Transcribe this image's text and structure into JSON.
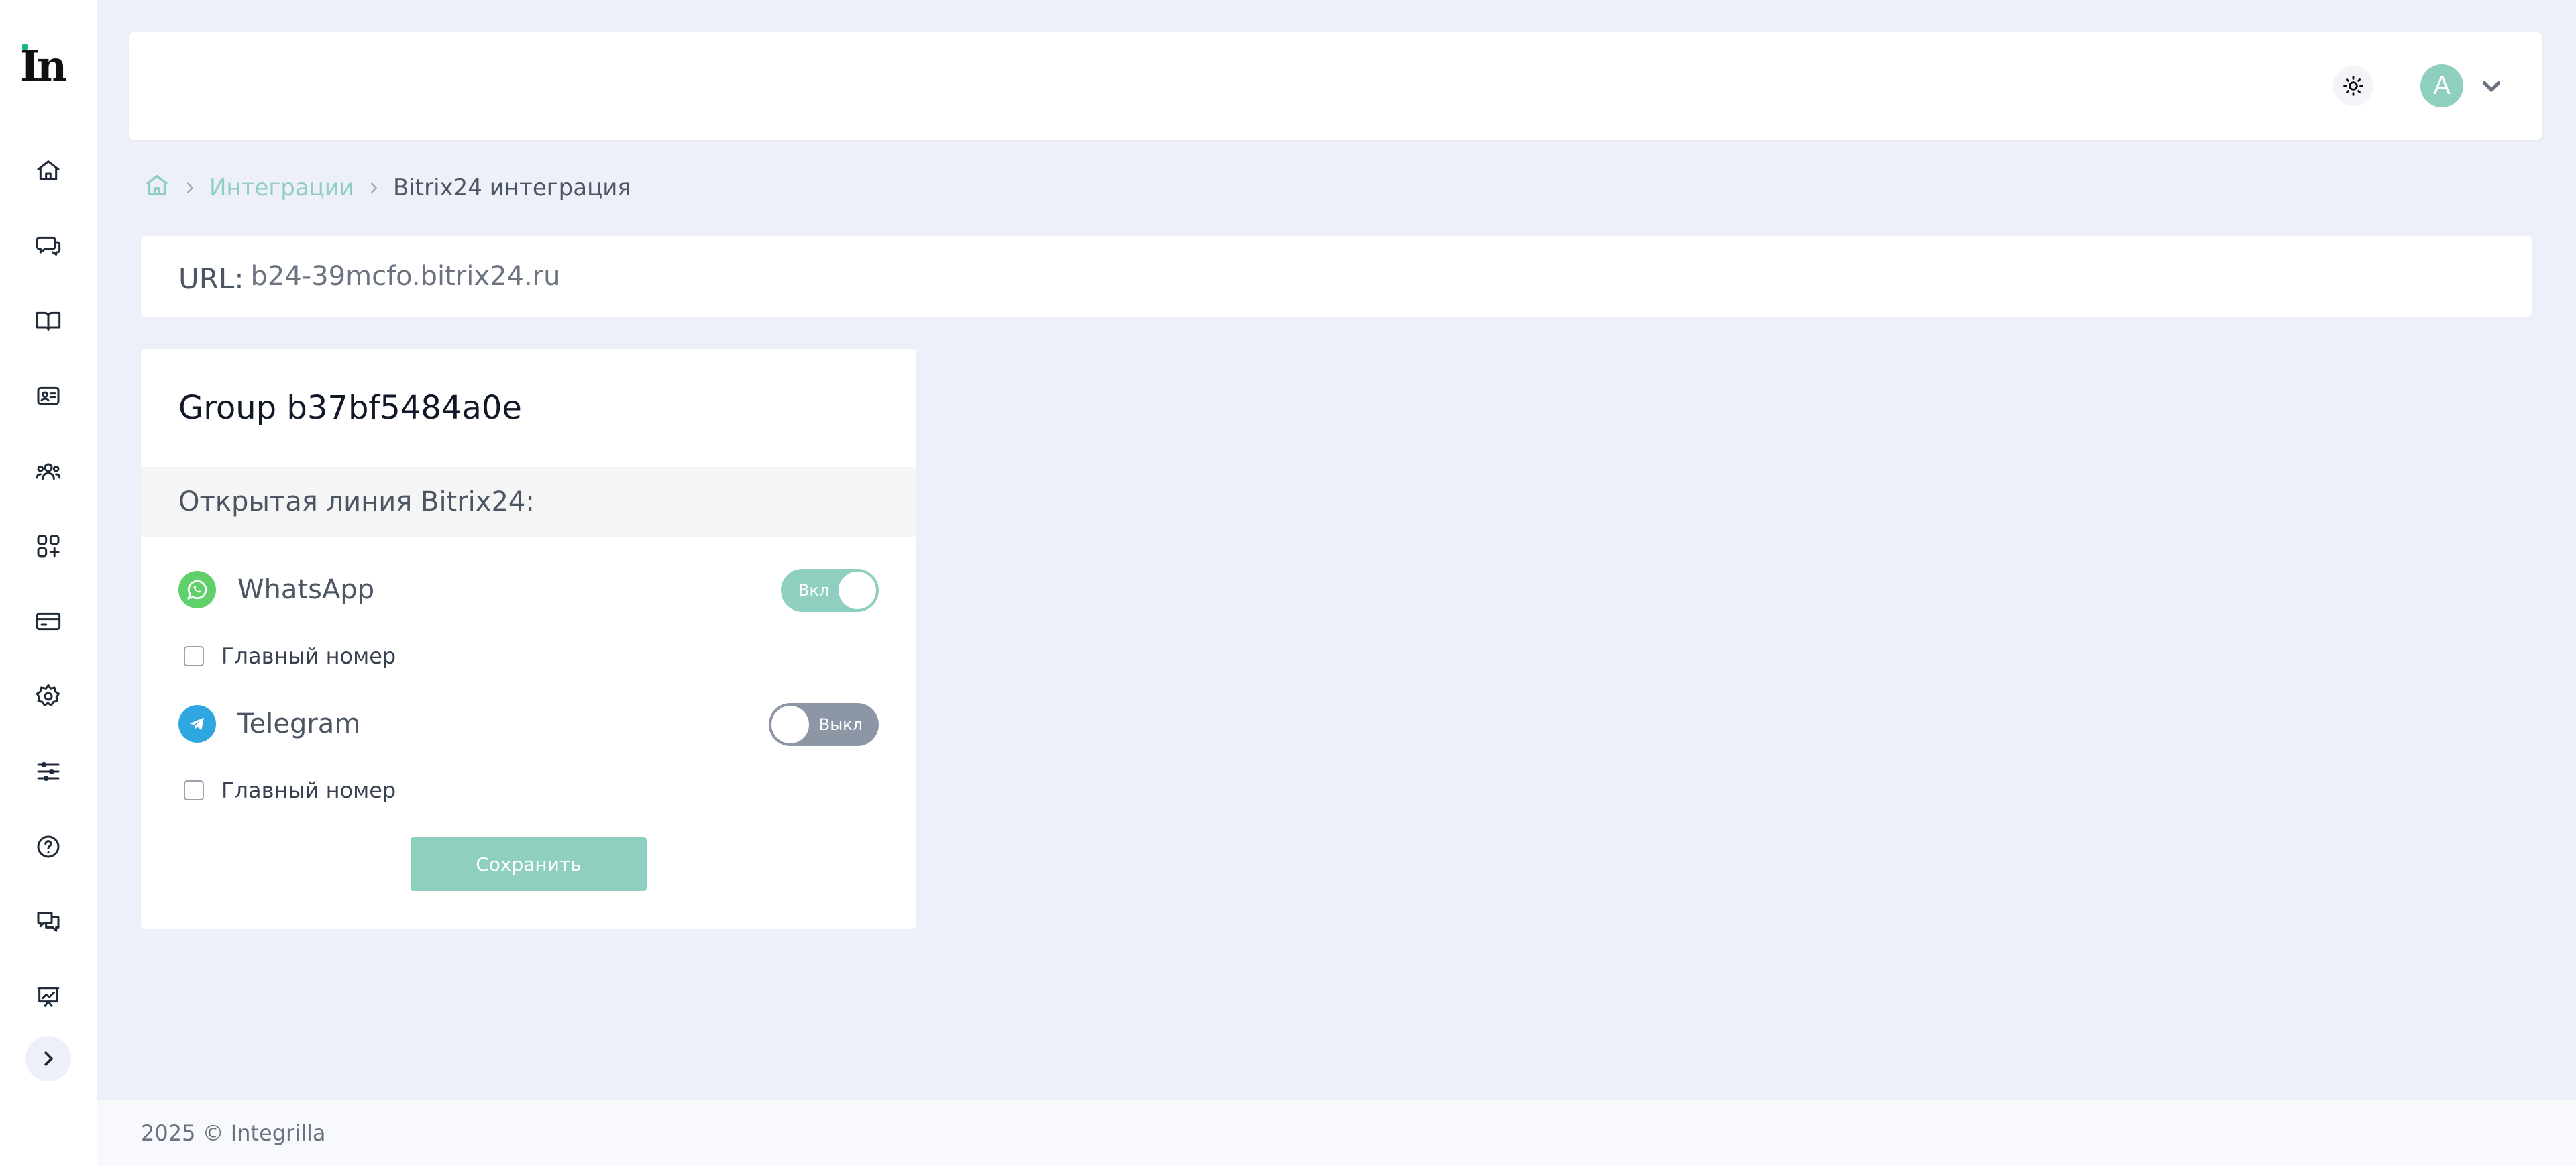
{
  "sidebar": {
    "logo_text": "In",
    "items": [
      {
        "icon": "home-icon"
      },
      {
        "icon": "chat-bubbles-icon"
      },
      {
        "icon": "book-icon"
      },
      {
        "icon": "contact-card-icon"
      },
      {
        "icon": "users-icon"
      },
      {
        "icon": "apps-add-icon"
      },
      {
        "icon": "credit-card-icon"
      },
      {
        "icon": "settings-gear-icon"
      },
      {
        "icon": "sliders-icon"
      },
      {
        "icon": "help-circle-icon"
      },
      {
        "icon": "messages-icon"
      },
      {
        "icon": "presentation-chart-icon"
      }
    ],
    "expand_icon": "chevron-right-icon"
  },
  "header": {
    "theme_icon": "sun-icon",
    "avatar_letter": "A",
    "menu_icon": "chevron-down-icon"
  },
  "breadcrumb": {
    "home_icon": "home-icon",
    "items": [
      "Интеграции",
      "Bitrix24 интеграция"
    ]
  },
  "url_bar": {
    "label": "URL:",
    "value": "b24-39mcfo.bitrix24.ru"
  },
  "card": {
    "title": "Group b37bf5484a0e",
    "section_title": "Открытая линия Bitrix24:",
    "channels": [
      {
        "name": "WhatsApp",
        "icon": "whatsapp-icon",
        "toggle_label": "Вкл",
        "enabled": true,
        "main_number_label": "Главный номер",
        "main_number_checked": false
      },
      {
        "name": "Telegram",
        "icon": "telegram-icon",
        "toggle_label": "Выкл",
        "enabled": false,
        "main_number_label": "Главный номер",
        "main_number_checked": false
      }
    ],
    "save_label": "Сохранить"
  },
  "footer": {
    "text": "2025 © Integrilla"
  },
  "colors": {
    "accent": "#8fcfbf",
    "background": "#eef0f9",
    "whatsapp": "#5fd06a",
    "telegram": "#2ea6e0",
    "toggle_off": "#8d96a4"
  }
}
